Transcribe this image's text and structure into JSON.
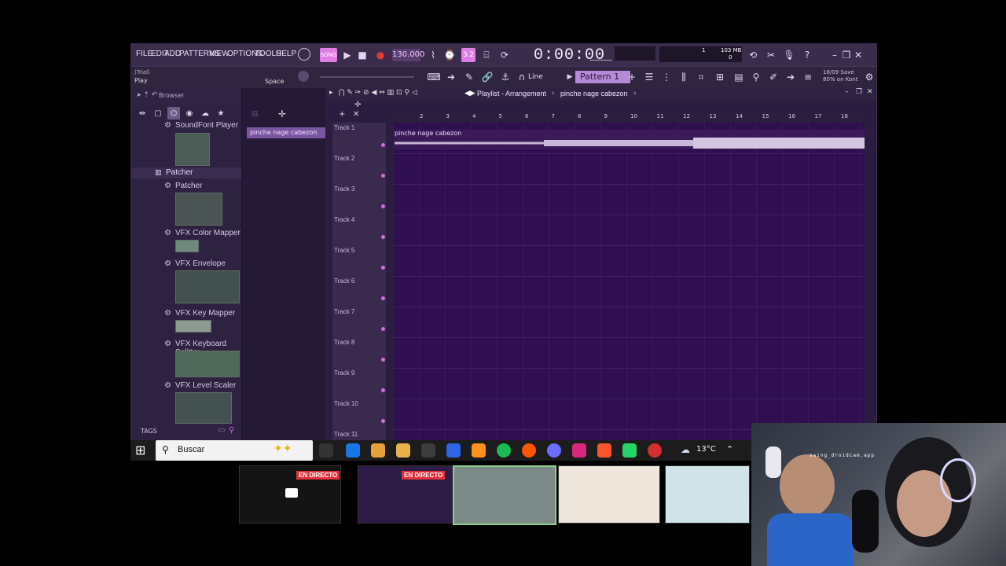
{
  "menu": [
    "FILE",
    "EDIT",
    "ADD",
    "PATTERNS",
    "VIEW",
    "OPTIONS",
    "TOOLS",
    "HELP"
  ],
  "hint": {
    "trial": "(Trial)",
    "play": "Play",
    "space": "Space"
  },
  "toolbar": {
    "tempo": "130.000",
    "time": "0:00:00",
    "pattern": "Pattern 1",
    "snap": "Line",
    "memory": "103 MB",
    "memory_zero": "0",
    "cpu_pct": "1",
    "news": "18/09 Save\n80% on Kont"
  },
  "browser": {
    "header": "Browser",
    "items": [
      {
        "label": "SoundFont Player"
      },
      {
        "label": "Patcher"
      },
      {
        "label": "Patcher"
      },
      {
        "label": "VFX Color Mapper"
      },
      {
        "label": "VFX Envelope"
      },
      {
        "label": "VFX Key Mapper"
      },
      {
        "label": "VFX Keyboard Splitter"
      },
      {
        "label": "VFX Level Scaler"
      }
    ],
    "tags": "TAGS"
  },
  "picker": {
    "item": "pinche nage cabezon"
  },
  "playlist": {
    "breadcrumb": [
      "Playlist - Arrangement",
      "pinche nage cabezon"
    ],
    "tracks": [
      "Track 1",
      "Track 2",
      "Track 3",
      "Track 4",
      "Track 5",
      "Track 6",
      "Track 7",
      "Track 8",
      "Track 9",
      "Track 10",
      "Track 11"
    ],
    "ruler": [
      "2",
      "3",
      "4",
      "5",
      "6",
      "7",
      "8",
      "9",
      "10",
      "11",
      "12",
      "13",
      "14",
      "15",
      "16",
      "17",
      "18"
    ],
    "clip_label": "pinche nage cabezon"
  },
  "taskbar": {
    "search_placeholder": "Buscar",
    "weather": "13°C"
  },
  "thumbnails": [
    {
      "badge": "EN DIRECTO"
    },
    {
      "badge": "EN DIRECTO"
    }
  ],
  "webcam_overlay": "swing_droidcam.app"
}
